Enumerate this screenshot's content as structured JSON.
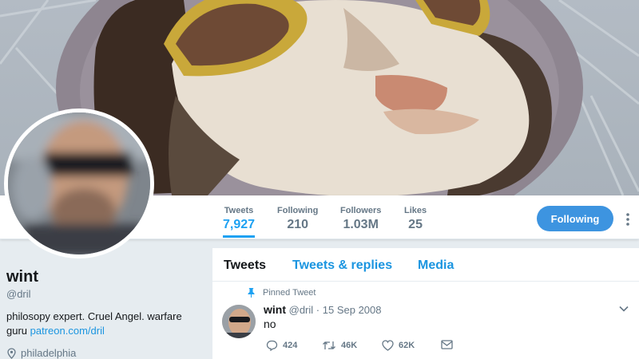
{
  "profile": {
    "name": "wint",
    "handle": "@dril",
    "bio_text": "philosopy expert. Cruel Angel. warfare guru",
    "bio_link": "patreon.com/dril",
    "location": "philadelphia"
  },
  "nav": {
    "stats": [
      {
        "label": "Tweets",
        "value": "7,927"
      },
      {
        "label": "Following",
        "value": "210"
      },
      {
        "label": "Followers",
        "value": "1.03M"
      },
      {
        "label": "Likes",
        "value": "25"
      }
    ],
    "follow_button": "Following"
  },
  "timeline": {
    "tabs": [
      "Tweets",
      "Tweets & replies",
      "Media"
    ],
    "pinned_label": "Pinned Tweet",
    "tweet": {
      "name": "wint",
      "handle": "@dril",
      "separator": "·",
      "date": "15 Sep 2008",
      "text": "no",
      "replies": "424",
      "retweets": "46K",
      "likes": "62K"
    }
  },
  "colors": {
    "accent": "#1da1f2",
    "follow_button": "#3d94e0",
    "background": "#e6ecf0"
  },
  "icons": [
    "pin-icon",
    "reply-icon",
    "retweet-icon",
    "like-icon",
    "dm-icon",
    "caret-down-icon",
    "location-pin-icon",
    "more-icon"
  ]
}
